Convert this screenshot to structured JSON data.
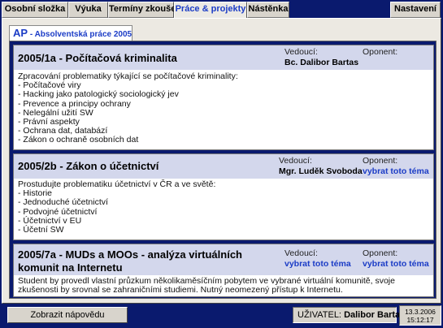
{
  "tabs": [
    {
      "label": "Osobní složka"
    },
    {
      "label": "Výuka"
    },
    {
      "label": "Termíny zkoušek"
    },
    {
      "label": "Práce & projekty",
      "active": true
    },
    {
      "label": "Nástěnka"
    },
    {
      "label": "Nastavení"
    }
  ],
  "subtab": {
    "code": "AP",
    "sep": " - ",
    "label": "Absolventská práce 2005"
  },
  "labels": {
    "supervisor": "Vedoucí:",
    "opponent": "Oponent:"
  },
  "projects": [
    {
      "title": "2005/1a - Počítačová kriminalita",
      "supervisor": "Bc. Dalibor Bartas",
      "opponent": "",
      "description_lines": [
        "Zpracování problematiky týkající se počítačové kriminality:",
        "- Počítačové viry",
        "- Hacking jako patologický sociologický jev",
        "- Prevence a principy ochrany",
        "- Nelegální užití SW",
        "- Právní aspekty",
        "- Ochrana dat, databází",
        "- Zákon o ochraně osobních dat"
      ]
    },
    {
      "title": "2005/2b - Zákon o účetnictví",
      "supervisor": "Mgr. Luděk Svoboda",
      "opponent": "vybrat toto téma",
      "description_lines": [
        "Prostudujte problematiku účetnictví v ČR a ve světě:",
        "- Historie",
        "- Jednoduché účetnictví",
        "- Podvojné účetnictví",
        "- Účetnictví v EU",
        "- Účetní SW"
      ]
    },
    {
      "title_line1": "2005/7a - MUDs a MOOs - analýza virtuálních",
      "title_line2": "komunit na Internetu",
      "supervisor": "vybrat toto téma",
      "opponent": "vybrat toto téma",
      "description": "Student by provedl vlastní průzkum několikaměsíčním pobytem ve vybrané virtuální komunitě, svoje zkušenosti by srovnal se zahraničními studiemi. Nutný neomezený přístup k Internetu."
    }
  ],
  "statusbar": {
    "help_button": "Zobrazit nápovědu",
    "user_label": "UŽIVATEL:",
    "user_name": "Dalibor Bartas",
    "date": "13.3.2006",
    "time": "15:12:17"
  },
  "colors": {
    "accent": "#1b3cc6",
    "background": "#0a1a6e",
    "card_header": "#d3d7ec"
  }
}
